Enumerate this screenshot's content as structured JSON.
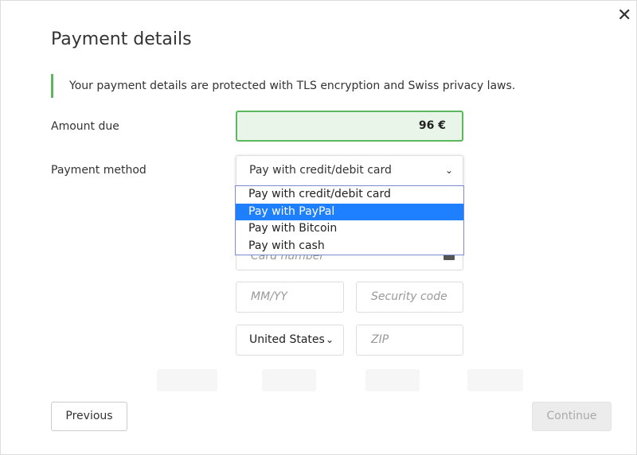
{
  "dialog": {
    "title": "Payment details",
    "close_icon": "close-icon",
    "notice": "Your payment details are protected with TLS encryption and Swiss privacy laws.",
    "notice_color": "#5cb85c"
  },
  "amount": {
    "label": "Amount due",
    "value": "96 €"
  },
  "method": {
    "label": "Payment method",
    "selected": "Pay with credit/debit card",
    "options": [
      "Pay with credit/debit card",
      "Pay with PayPal",
      "Pay with Bitcoin",
      "Pay with cash"
    ],
    "highlighted": "Pay with PayPal",
    "highlight_color": "#1e7fff"
  },
  "card": {
    "number_placeholder": "Card number",
    "expiry_placeholder": "MM/YY",
    "cvc_placeholder": "Security code",
    "country": "United States",
    "zip_placeholder": "ZIP"
  },
  "footer": {
    "previous": "Previous",
    "continue": "Continue"
  }
}
